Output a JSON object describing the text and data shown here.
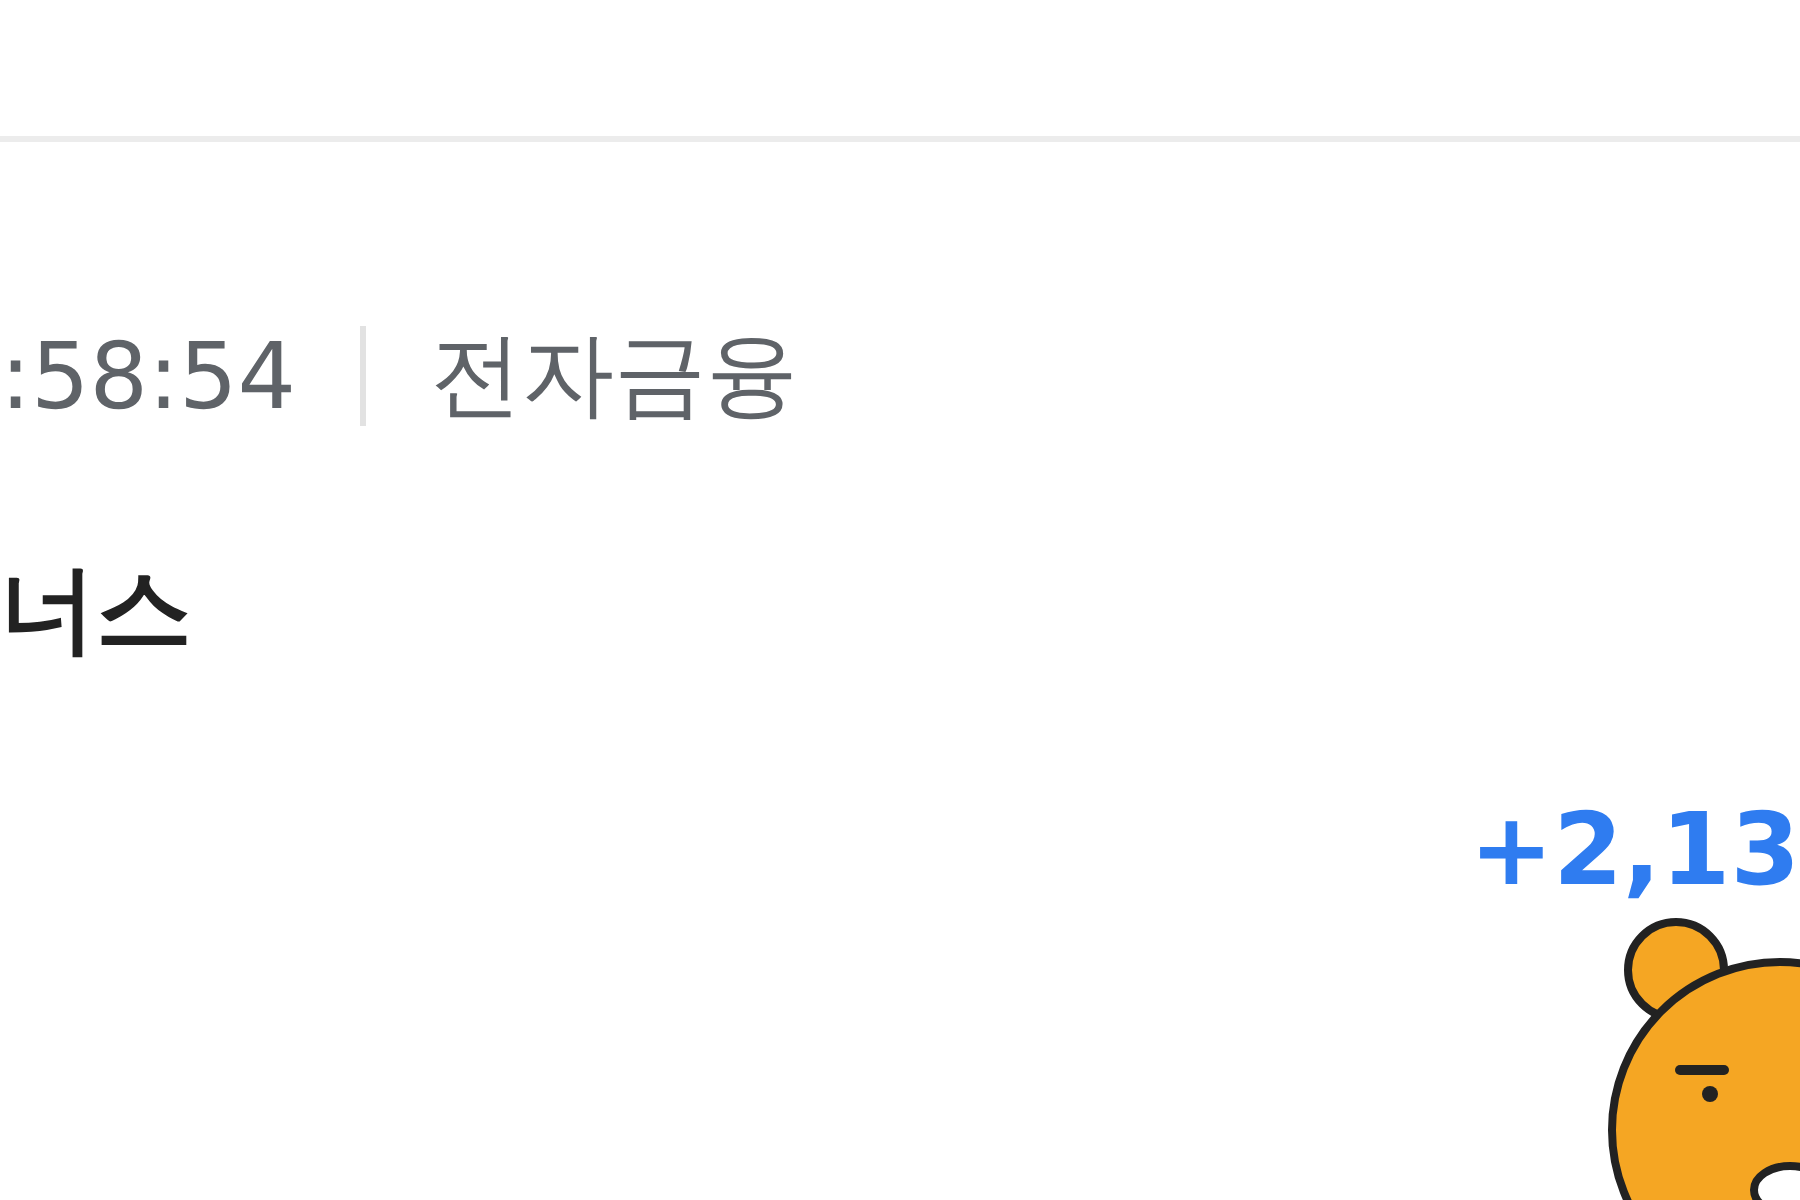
{
  "meta": {
    "time": ":58:54",
    "category": "전자금융"
  },
  "title": "너스",
  "amount": "+2,13"
}
